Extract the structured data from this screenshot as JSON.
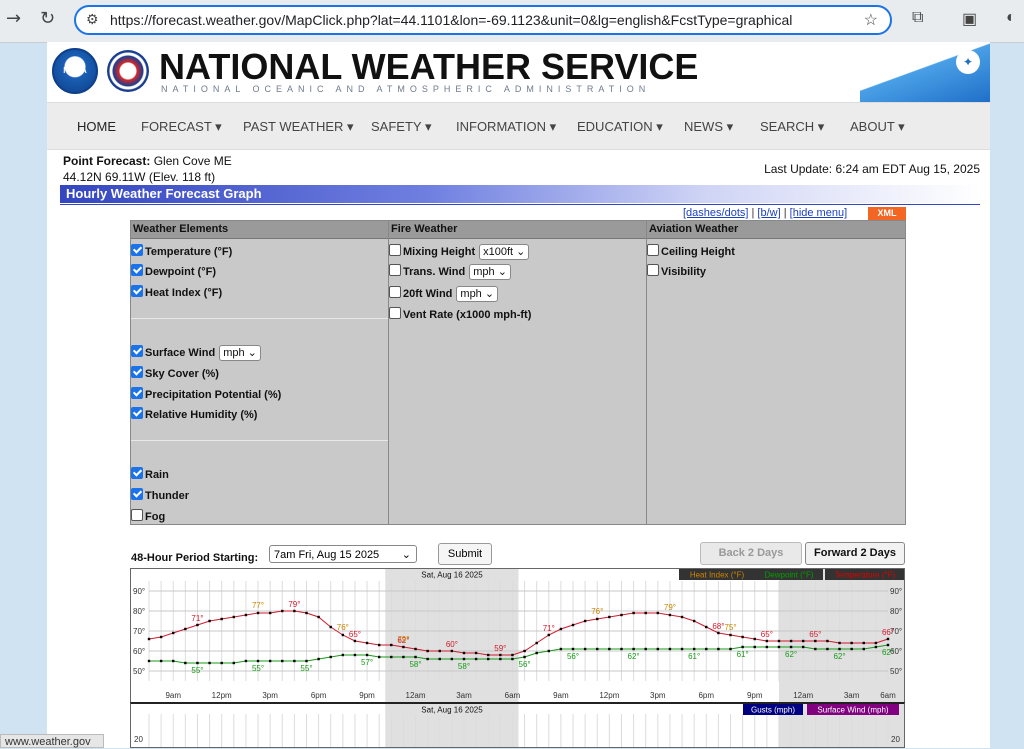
{
  "browser": {
    "url": "https://forecast.weather.gov/MapClick.php?lat=44.1101&lon=-69.1123&unit=0&lg=english&FcstType=graphical",
    "status_url": "www.weather.gov"
  },
  "header": {
    "title": "NATIONAL WEATHER SERVICE",
    "subtitle": "NATIONAL OCEANIC AND ATMOSPHERIC ADMINISTRATION",
    "noaa_logo_text": "NOAA"
  },
  "menu": [
    "HOME",
    "FORECAST ▾",
    "PAST WEATHER ▾",
    "SAFETY ▾",
    "INFORMATION ▾",
    "EDUCATION ▾",
    "NEWS ▾",
    "SEARCH ▾",
    "ABOUT ▾"
  ],
  "point": {
    "label": "Point Forecast:",
    "place": "Glen Cove ME",
    "coords": "44.12N 69.11W (Elev. 118 ft)",
    "last_update": "Last Update: 6:24 am EDT Aug 15, 2025"
  },
  "graph_title": "Hourly Weather Forecast Graph",
  "links": {
    "dashes": "[dashes/dots]",
    "bw": "[b/w]",
    "hide": "[hide menu]",
    "sep": "|",
    "xml": "XML"
  },
  "weather_elements": {
    "header": "Weather Elements",
    "group1": [
      {
        "label": "Temperature (°F)",
        "checked": true
      },
      {
        "label": "Dewpoint (°F)",
        "checked": true
      },
      {
        "label": "Heat Index (°F)",
        "checked": true
      }
    ],
    "group2": [
      {
        "label": "Surface Wind",
        "checked": true,
        "select": "mph"
      },
      {
        "label": "Sky Cover (%)",
        "checked": true
      },
      {
        "label": "Precipitation Potential (%)",
        "checked": true
      },
      {
        "label": "Relative Humidity (%)",
        "checked": true
      }
    ],
    "group3": [
      {
        "label": "Rain",
        "checked": true
      },
      {
        "label": "Thunder",
        "checked": true
      },
      {
        "label": "Fog",
        "checked": false
      }
    ]
  },
  "fire_weather": {
    "header": "Fire Weather",
    "items": [
      {
        "label": "Mixing Height",
        "checked": false,
        "select": "x100ft"
      },
      {
        "label": "Trans. Wind",
        "checked": false,
        "select": "mph"
      },
      {
        "label": "20ft Wind",
        "checked": false,
        "select": "mph"
      },
      {
        "label": "Vent Rate (x1000 mph-ft)",
        "checked": false
      }
    ]
  },
  "aviation_weather": {
    "header": "Aviation Weather",
    "items": [
      {
        "label": "Ceiling Height",
        "checked": false
      },
      {
        "label": "Visibility",
        "checked": false
      }
    ]
  },
  "controls": {
    "period_label": "48-Hour Period Starting:",
    "period_value": "7am Fri, Aug 15 2025",
    "submit": "Submit",
    "back": "Back 2 Days",
    "forward": "Forward 2 Days"
  },
  "chart_data": [
    {
      "type": "line",
      "title": "",
      "date_label": "Sat, Aug 16 2025",
      "x_ticks": [
        "9am",
        "12pm",
        "3pm",
        "6pm",
        "9pm",
        "12am",
        "3am",
        "6am",
        "9am",
        "12pm",
        "3pm",
        "6pm",
        "9pm",
        "12am",
        "3am",
        "6am"
      ],
      "y_ticks": [
        "90°",
        "80°",
        "70°",
        "60°",
        "50°"
      ],
      "ylim": [
        45,
        95
      ],
      "legend": [
        "Heat Index (°F)",
        "Dewpoint (°F)",
        "Temperature (°F)"
      ],
      "legend_colors": [
        "#cc8400",
        "#00a000",
        "#e00000"
      ],
      "colors": {
        "temperature": "#d4182a",
        "heat_index": "#cc8400",
        "dewpoint": "#169c16"
      },
      "series": [
        {
          "name": "Temperature (°F)",
          "values": [
            66,
            67,
            69,
            71,
            73,
            75,
            76,
            77,
            78,
            79,
            79,
            80,
            80,
            79,
            77,
            72,
            68,
            65,
            64,
            63,
            63,
            62,
            61,
            60,
            60,
            60,
            59,
            59,
            58,
            58,
            58,
            60,
            64,
            68,
            71,
            73,
            75,
            76,
            77,
            78,
            79,
            79,
            79,
            78,
            77,
            75,
            72,
            69,
            68,
            67,
            66,
            65,
            65,
            65,
            65,
            65,
            65,
            64,
            64,
            64,
            64,
            66
          ]
        },
        {
          "name": "Dewpoint (°F)",
          "values": [
            55,
            55,
            55,
            54,
            54,
            54,
            54,
            54,
            55,
            55,
            55,
            55,
            55,
            55,
            56,
            57,
            58,
            58,
            58,
            57,
            57,
            57,
            57,
            56,
            56,
            56,
            56,
            56,
            56,
            56,
            56,
            57,
            59,
            60,
            61,
            61,
            61,
            61,
            61,
            61,
            61,
            61,
            61,
            61,
            61,
            61,
            61,
            61,
            61,
            62,
            62,
            62,
            62,
            62,
            62,
            61,
            61,
            61,
            61,
            61,
            62,
            63
          ]
        }
      ],
      "temp_labels": [
        {
          "i": 4,
          "t": "71°"
        },
        {
          "i": 12,
          "t": "79°"
        },
        {
          "i": 17,
          "t": "65°"
        },
        {
          "i": 21,
          "t": "62°"
        },
        {
          "i": 25,
          "t": "60°"
        },
        {
          "i": 29,
          "t": "59°"
        },
        {
          "i": 33,
          "t": "71°"
        },
        {
          "i": 47,
          "t": "68°"
        },
        {
          "i": 51,
          "t": "65°"
        },
        {
          "i": 55,
          "t": "65°"
        },
        {
          "i": 61,
          "t": "66°"
        }
      ],
      "heat_labels": [
        {
          "i": 9,
          "t": "77°"
        },
        {
          "i": 21,
          "t": "79°"
        },
        {
          "i": 16,
          "t": "76°"
        },
        {
          "i": 37,
          "t": "76°"
        },
        {
          "i": 43,
          "t": "79°"
        },
        {
          "i": 48,
          "t": "75°"
        }
      ],
      "dew_labels": [
        {
          "i": 4,
          "t": "55°"
        },
        {
          "i": 9,
          "t": "55°"
        },
        {
          "i": 13,
          "t": "55°"
        },
        {
          "i": 18,
          "t": "57°"
        },
        {
          "i": 22,
          "t": "58°"
        },
        {
          "i": 26,
          "t": "58°"
        },
        {
          "i": 31,
          "t": "56°"
        },
        {
          "i": 35,
          "t": "56°"
        },
        {
          "i": 40,
          "t": "62°"
        },
        {
          "i": 45,
          "t": "61°"
        },
        {
          "i": 49,
          "t": "61°"
        },
        {
          "i": 53,
          "t": "62°"
        },
        {
          "i": 57,
          "t": "62°"
        },
        {
          "i": 61,
          "t": "62°"
        }
      ]
    },
    {
      "type": "line",
      "title": "",
      "date_label": "Sat, Aug 16 2025",
      "legend": [
        "Gusts (mph)",
        "Surface Wind (mph)"
      ],
      "legend_colors": [
        "#000080",
        "#800080"
      ],
      "y_ticks": [
        "20"
      ]
    }
  ]
}
